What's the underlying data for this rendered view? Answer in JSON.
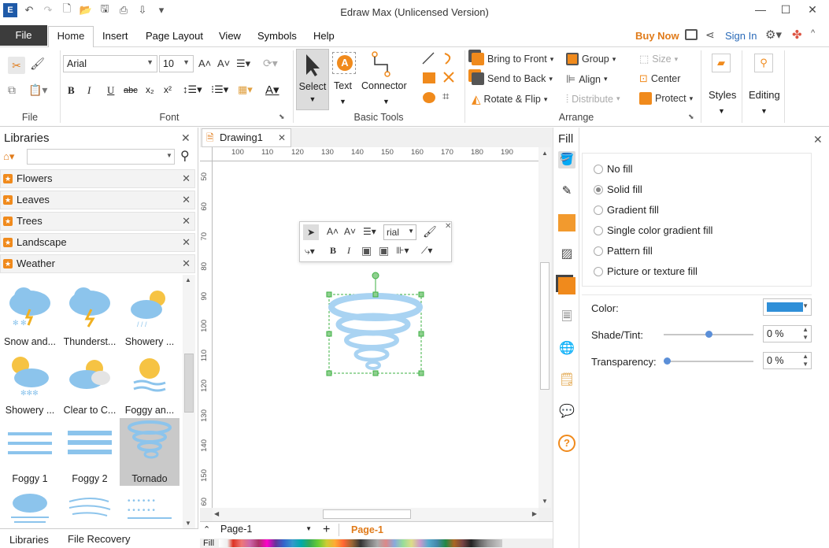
{
  "window": {
    "title": "Edraw Max (Unlicensed Version)",
    "buy_now": "Buy Now",
    "sign_in": "Sign In"
  },
  "menu": {
    "file": "File",
    "tabs": [
      "Home",
      "Insert",
      "Page Layout",
      "View",
      "Symbols",
      "Help"
    ]
  },
  "ribbon": {
    "groups": {
      "file": "File",
      "font": "Font",
      "basic_tools": "Basic Tools",
      "arrange": "Arrange"
    },
    "font_name": "Arial",
    "font_size": "10",
    "select": "Select",
    "text": "Text",
    "connector": "Connector",
    "bring_to_front": "Bring to Front",
    "send_to_back": "Send to Back",
    "rotate_flip": "Rotate & Flip",
    "group": "Group",
    "align": "Align",
    "distribute": "Distribute",
    "size": "Size",
    "center": "Center",
    "protect": "Protect",
    "styles": "Styles",
    "editing": "Editing"
  },
  "libraries": {
    "title": "Libraries",
    "search_value": "",
    "items": [
      "Flowers",
      "Leaves",
      "Trees",
      "Landscape",
      "Weather"
    ],
    "shapes": [
      {
        "label": "Snow and..."
      },
      {
        "label": "Thunderst..."
      },
      {
        "label": "Showery ..."
      },
      {
        "label": "Showery ..."
      },
      {
        "label": "Clear to C..."
      },
      {
        "label": "Foggy an..."
      },
      {
        "label": "Foggy 1"
      },
      {
        "label": "Foggy 2"
      },
      {
        "label": "Tornado"
      }
    ],
    "bottom_tabs": [
      "Libraries",
      "File Recovery"
    ]
  },
  "document": {
    "tab": "Drawing1",
    "h_ruler": [
      "100",
      "110",
      "120",
      "130",
      "140",
      "150",
      "160",
      "170",
      "180",
      "190"
    ],
    "v_ruler": [
      "50",
      "60",
      "70",
      "80",
      "90",
      "100",
      "110",
      "120",
      "130",
      "140",
      "150",
      "60"
    ],
    "page_select": "Page-1",
    "page_tab": "Page-1",
    "fill_label": "Fill",
    "float_font": "rial"
  },
  "fill_panel": {
    "title": "Fill",
    "options": [
      "No fill",
      "Solid fill",
      "Gradient fill",
      "Single color gradient fill",
      "Pattern fill",
      "Picture or texture fill"
    ],
    "selected_option": "Solid fill",
    "color_label": "Color:",
    "color_value": "#2f8fd8",
    "shade_label": "Shade/Tint:",
    "shade_value": "0 %",
    "shade_level": 0.5,
    "transparency_label": "Transparency:",
    "transparency_value": "0 %",
    "transparency_level": 0
  },
  "colors": {
    "accent_orange": "#f08a1c",
    "file_tab_bg": "#3c3c3c",
    "selection_green": "#3cb043",
    "tornado_blue": "#a9d3f2"
  }
}
